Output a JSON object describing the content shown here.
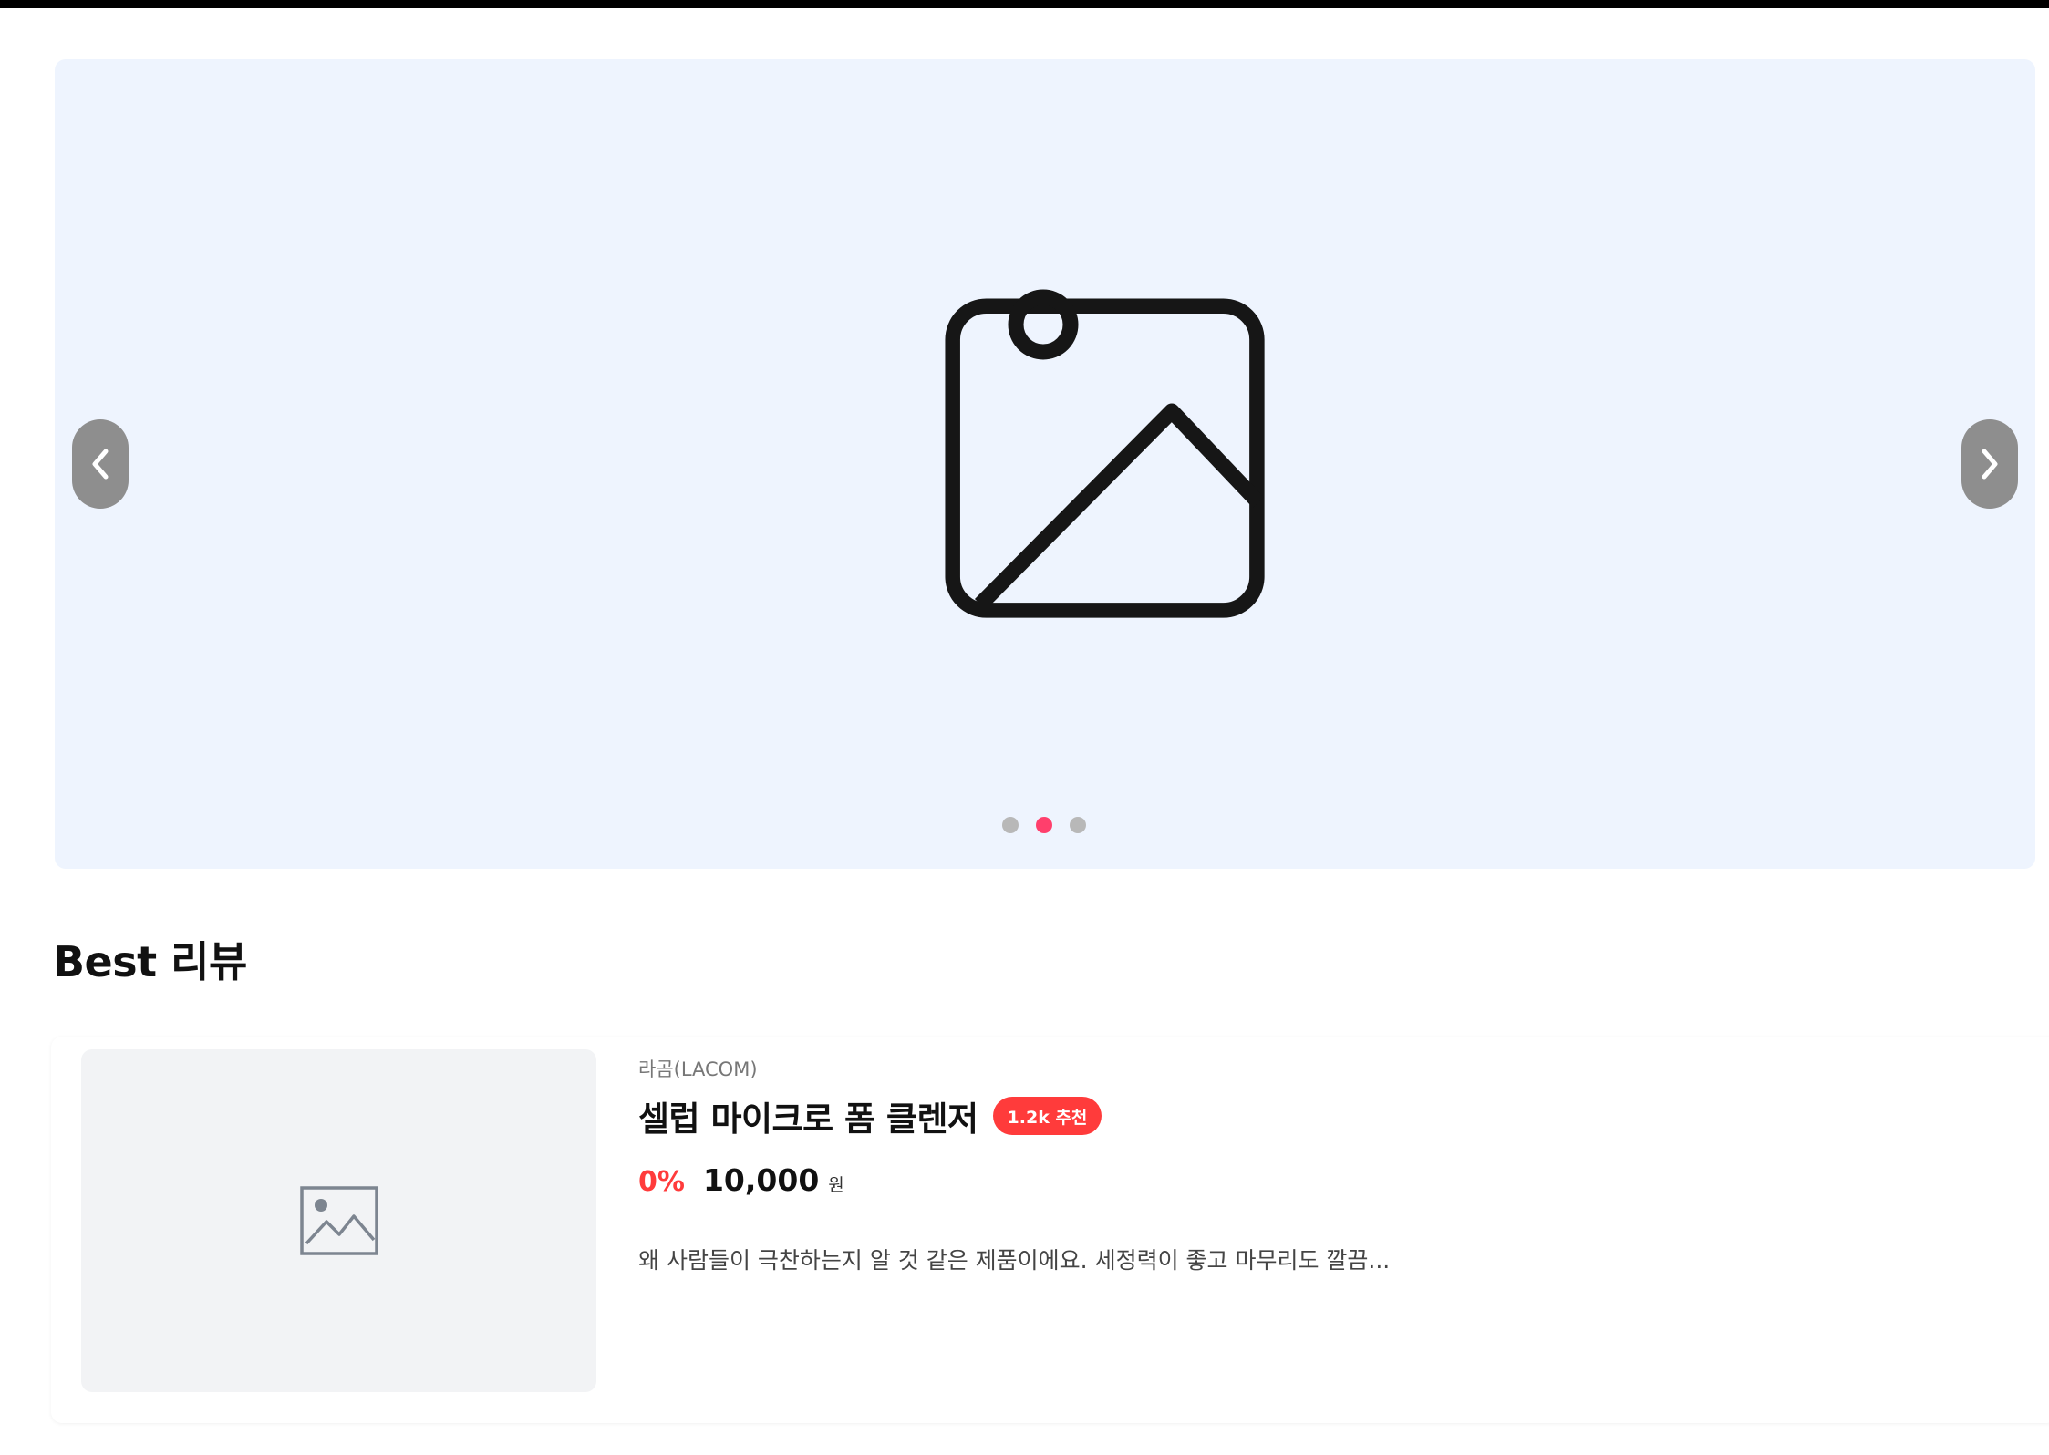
{
  "banner": {
    "image_icon": "image-placeholder-icon",
    "prev_icon": "chevron-left-icon",
    "next_icon": "chevron-right-icon",
    "dots_total": 3,
    "active_dot": 2
  },
  "section": {
    "title": "Best 리뷰"
  },
  "review": {
    "brand": "라곰(LACOM)",
    "product_name": "셀럽 마이크로 폼 클렌저",
    "badge": "1.2k 추천",
    "discount": "0%",
    "price": "10,000",
    "currency": "원",
    "text": "왜 사람들이 극찬하는지 알 것 같은 제품이에요. 세정력이 좋고 마무리도 깔끔...",
    "thumb_icon": "image-placeholder-icon"
  },
  "colors": {
    "accent": "#ff3b3b",
    "active_dot": "#ff3f6c",
    "banner_bg": "#eef4fe"
  }
}
